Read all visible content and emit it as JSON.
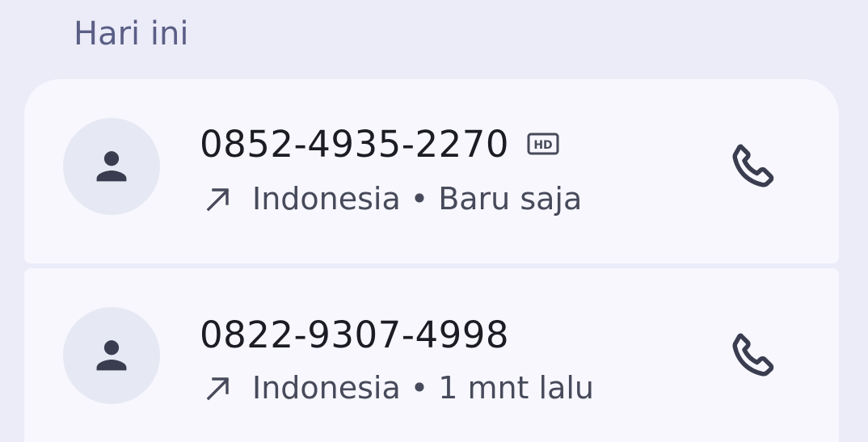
{
  "section": {
    "title": "Hari ini"
  },
  "calls": [
    {
      "number": "0852-4935-2270",
      "hd": true,
      "direction": "outgoing-arrow-icon",
      "location": "Indonesia",
      "separator": "•",
      "time": "Baru saja"
    },
    {
      "number": "0822-9307-4998",
      "hd": false,
      "direction": "outgoing-arrow-icon",
      "location": "Indonesia",
      "separator": "•",
      "time": "1 mnt lalu"
    }
  ],
  "colors": {
    "background": "#ebecf8",
    "card": "#f7f7fd",
    "avatar_bg": "#e6e8f3",
    "icon": "#3a3d4f",
    "header_text": "#5b5e85",
    "primary_text": "#1c1c24",
    "secondary_text": "#474a5a"
  },
  "icons": {
    "avatar": "person-icon",
    "hd": "hd-badge-icon",
    "call": "phone-icon"
  }
}
